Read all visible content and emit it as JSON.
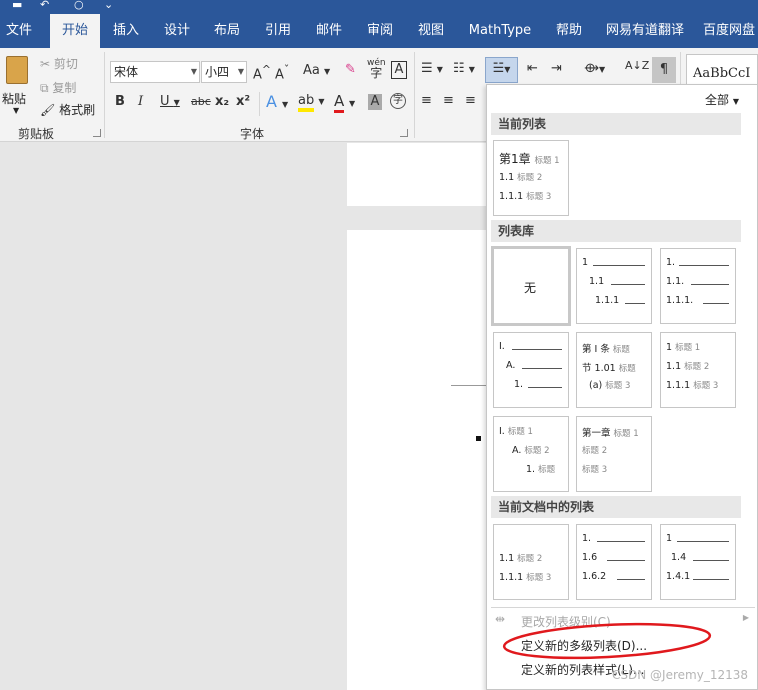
{
  "quick_access": [
    "save-icon",
    "undo-icon",
    "redo-icon",
    "dropdown-icon"
  ],
  "tabs": [
    "文件",
    "开始",
    "插入",
    "设计",
    "布局",
    "引用",
    "邮件",
    "审阅",
    "视图",
    "MathType",
    "帮助",
    "网易有道翻译",
    "百度网盘"
  ],
  "clipboard": {
    "paste": "粘贴",
    "cut": "剪切",
    "copy": "复制",
    "format_painter": "格式刷",
    "group_label": "剪贴板"
  },
  "font": {
    "name": "宋体",
    "size": "小四",
    "group_label": "字体",
    "bold": "B",
    "italic": "I",
    "underline": "U",
    "strike": "abc",
    "subscript": "x₂",
    "superscript": "x²",
    "wen_char": "字",
    "pinyin": "wén",
    "grow": "A",
    "shrink": "A",
    "case": "Aa",
    "border_char": "A",
    "shade_char": "A"
  },
  "styles": {
    "preview": "AaBbCcI"
  },
  "menu": {
    "filter": "全部",
    "sections": {
      "current": "当前列表",
      "library": "列表库",
      "in_document": "当前文档中的列表"
    },
    "current_tile": [
      {
        "num": "第1章",
        "label": "标题 1"
      },
      {
        "num": "1.1",
        "label": "标题 2"
      },
      {
        "num": "1.1.1",
        "label": "标题 3"
      }
    ],
    "library_tiles": [
      {
        "lines": [
          "无"
        ]
      },
      {
        "lines": [
          "1",
          "1.1",
          "1.1.1"
        ]
      },
      {
        "lines": [
          "1.",
          "1.1.",
          "1.1.1."
        ]
      },
      {
        "lines": [
          "I.",
          "A.",
          "1."
        ]
      },
      {
        "lines": [
          "第 I 条",
          "节 1.01",
          "(a)"
        ],
        "labels": [
          "标题",
          "标题",
          "标题 3"
        ]
      },
      {
        "lines": [
          "1",
          "1.1",
          "1.1.1"
        ],
        "labels": [
          "标题 1",
          "标题 2",
          "标题 3"
        ]
      },
      {
        "lines": [
          "I.",
          "A.",
          "1."
        ],
        "labels": [
          "标题 1",
          "标题 2",
          "标题"
        ]
      },
      {
        "lines": [
          "第一章",
          "",
          ""
        ],
        "labels": [
          "标题 1",
          "标题 2",
          "标题 3"
        ]
      }
    ],
    "doc_tiles": [
      {
        "lines": [
          "1.1",
          "1.1.1"
        ],
        "labels": [
          "标题 2",
          "标题 3"
        ]
      },
      {
        "lines": [
          "1.",
          "1.6",
          "1.6.2"
        ]
      },
      {
        "lines": [
          "1",
          "1.4",
          "1.4.1"
        ]
      }
    ],
    "items": {
      "change_level": "更改列表级别(C)",
      "define_multilevel": "定义新的多级列表(D)...",
      "define_style": "定义新的列表样式(L)..."
    }
  },
  "watermark": "CSDN @Jeremy_12138",
  "colors": {
    "accent": "#2b579a",
    "annotation": "#e0191d"
  }
}
